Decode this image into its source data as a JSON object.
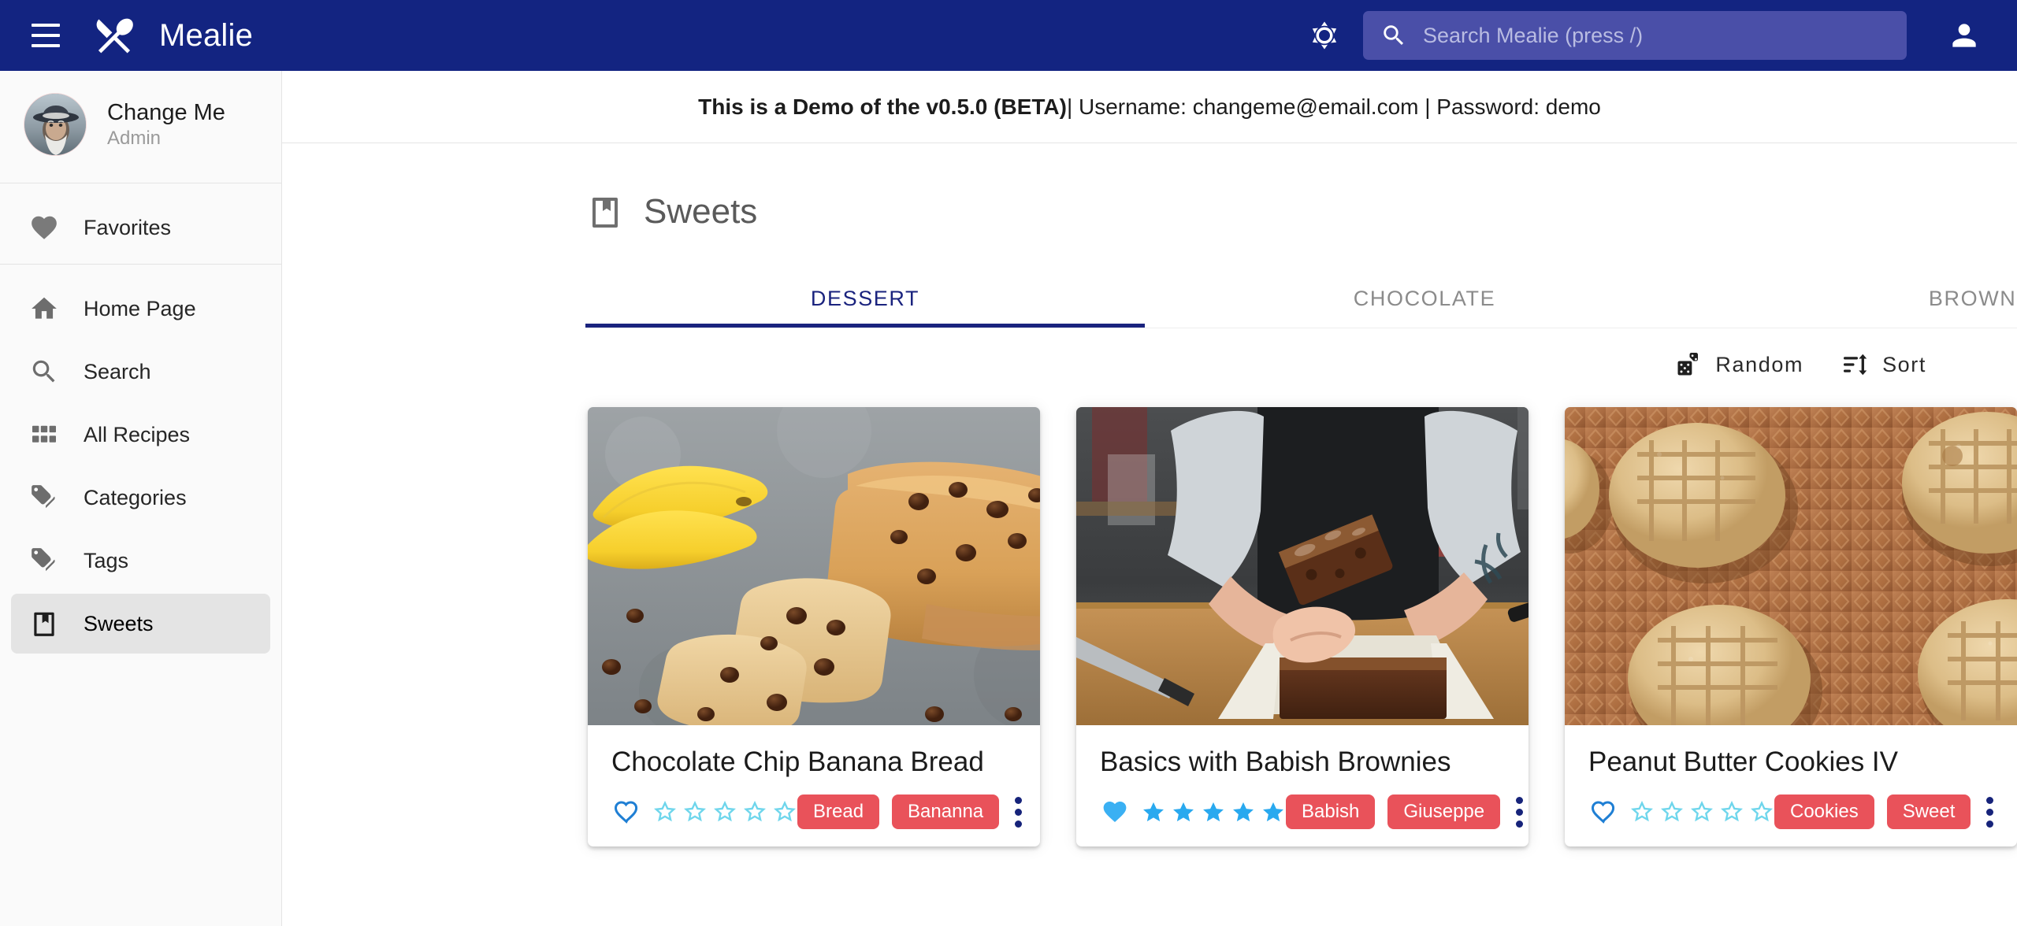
{
  "app": {
    "brand_title": "Mealie",
    "menu_icon": "hamburger-menu-icon",
    "logo_icon": "fork-knife-logo-icon",
    "theme_icon": "brightness-theme-icon",
    "account_icon": "account-avatar-icon",
    "accent_blue": "#132481",
    "search_field_bg": "#4a4fa8"
  },
  "search": {
    "placeholder": "Search Mealie (press /)",
    "value": "",
    "icon": "search-icon"
  },
  "sidebar": {
    "user": {
      "name": "Change Me",
      "role": "Admin",
      "avatar_alt": "avatar"
    },
    "favorites": {
      "label": "Favorites",
      "icon": "heart-icon"
    },
    "items": [
      {
        "label": "Home Page",
        "icon": "home-icon",
        "active": false
      },
      {
        "label": "Search",
        "icon": "search-icon",
        "active": false
      },
      {
        "label": "All Recipes",
        "icon": "grid-icon",
        "active": false
      },
      {
        "label": "Categories",
        "icon": "tag-multiple-icon",
        "active": false
      },
      {
        "label": "Tags",
        "icon": "tag-multiple-icon",
        "active": false
      },
      {
        "label": "Sweets",
        "icon": "book-icon",
        "active": true
      }
    ]
  },
  "banner": {
    "bold_text": "This is a Demo of the v0.5.0 (BETA)",
    "rest_text": " | Username: changeme@email.com | Password: demo"
  },
  "page": {
    "title": "Sweets",
    "title_icon": "book-icon"
  },
  "tabs": [
    {
      "label": "Dessert",
      "active": true
    },
    {
      "label": "Chocolate",
      "active": false
    },
    {
      "label": "Brownie",
      "active": false
    }
  ],
  "toolbar": {
    "random_label": "Random",
    "random_icon": "dice-icon",
    "sort_label": "Sort",
    "sort_icon": "sort-variant-icon"
  },
  "colors": {
    "chip_red": "#e9525a",
    "star_empty": "#6fd6ec",
    "star_filled": "#29a9ef",
    "heart_empty": "#1f7fd4",
    "heart_filled": "#3ab0f3",
    "tab_active": "#1a237e",
    "dots": "#16237a"
  },
  "recipes": [
    {
      "title": "Chocolate Chip Banana Bread",
      "image_alt": "chocolate-chip-banana-bread-photo",
      "favorite": false,
      "rating": 0,
      "max_rating": 5,
      "tags": [
        "Bread",
        "Bananna"
      ],
      "menu_icon": "dots-vertical-icon"
    },
    {
      "title": "Basics with Babish Brownies",
      "image_alt": "babish-brownies-photo",
      "favorite": true,
      "rating": 5,
      "max_rating": 5,
      "tags": [
        "Babish",
        "Giuseppe"
      ],
      "menu_icon": "dots-vertical-icon"
    },
    {
      "title": "Peanut Butter Cookies IV",
      "image_alt": "peanut-butter-cookies-photo",
      "favorite": false,
      "rating": 0,
      "max_rating": 5,
      "tags": [
        "Cookies",
        "Sweet"
      ],
      "menu_icon": "dots-vertical-icon"
    }
  ]
}
